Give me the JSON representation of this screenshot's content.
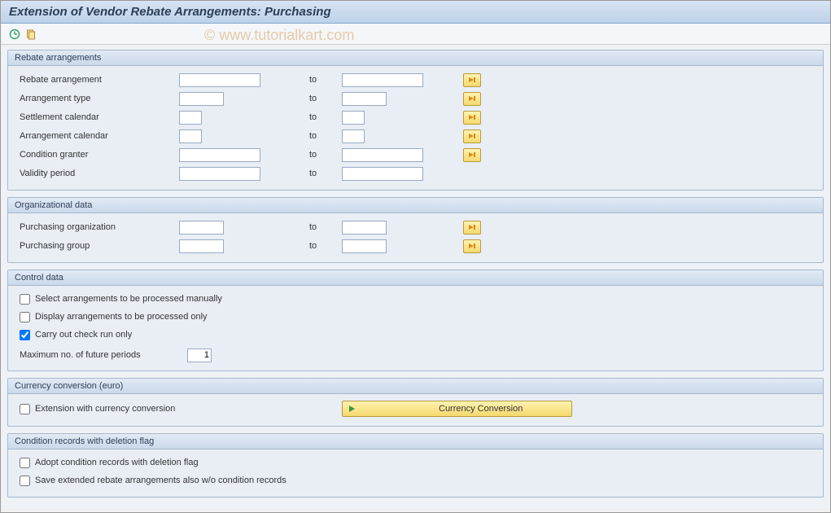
{
  "title": "Extension of Vendor Rebate Arrangements: Purchasing",
  "watermark": "© www.tutorialkart.com",
  "groups": {
    "rebate": {
      "header": "Rebate arrangements",
      "rows": {
        "rebate_arrangement": {
          "label": "Rebate arrangement",
          "to": "to"
        },
        "arrangement_type": {
          "label": "Arrangement type",
          "to": "to"
        },
        "settlement_calendar": {
          "label": "Settlement calendar",
          "to": "to"
        },
        "arrangement_calendar": {
          "label": "Arrangement calendar",
          "to": "to"
        },
        "condition_granter": {
          "label": "Condition granter",
          "to": "to"
        },
        "validity_period": {
          "label": "Validity period",
          "to": "to"
        }
      }
    },
    "org": {
      "header": "Organizational data",
      "rows": {
        "purchasing_org": {
          "label": "Purchasing organization",
          "to": "to"
        },
        "purchasing_group": {
          "label": "Purchasing group",
          "to": "to"
        }
      }
    },
    "control": {
      "header": "Control data",
      "checks": {
        "select_manual": {
          "label": "Select arrangements to be processed manually",
          "checked": false
        },
        "display_only": {
          "label": "Display arrangements to be processed only",
          "checked": false
        },
        "check_run": {
          "label": "Carry out check run only",
          "checked": true
        }
      },
      "max_periods": {
        "label": "Maximum no. of future periods",
        "value": "1"
      }
    },
    "currency": {
      "header": "Currency conversion (euro)",
      "check": {
        "label": "Extension with currency conversion",
        "checked": false
      },
      "button": "Currency Conversion"
    },
    "deletion": {
      "header": "Condition records with deletion flag",
      "checks": {
        "adopt": {
          "label": "Adopt condition records with deletion flag",
          "checked": false
        },
        "save_extended": {
          "label": "Save extended rebate arrangements also w/o condition records",
          "checked": false
        }
      }
    }
  }
}
